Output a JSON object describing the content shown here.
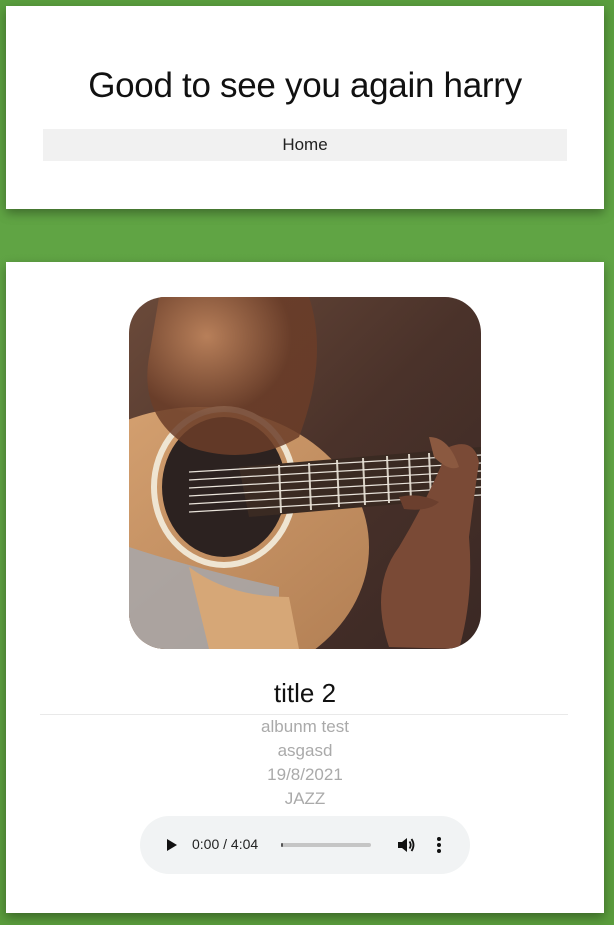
{
  "header": {
    "greeting": "Good to see you again harry",
    "nav": {
      "home_label": "Home"
    }
  },
  "song": {
    "cover_icon": "guitar-photo",
    "title": "title 2",
    "album": "albunm test",
    "artist": "asgasd",
    "date": "19/8/2021",
    "genre": "JAZZ"
  },
  "player": {
    "time_display": "0:00 / 4:04",
    "progress": 0,
    "icons": {
      "play": "play-icon",
      "volume": "volume-icon",
      "more": "more-vertical-icon"
    }
  },
  "colors": {
    "background": "#5f9f42",
    "card": "#ffffff",
    "nav_bg": "#f1f1f1",
    "meta_text": "#aaaaaa",
    "player_bg": "#f1f3f4"
  }
}
